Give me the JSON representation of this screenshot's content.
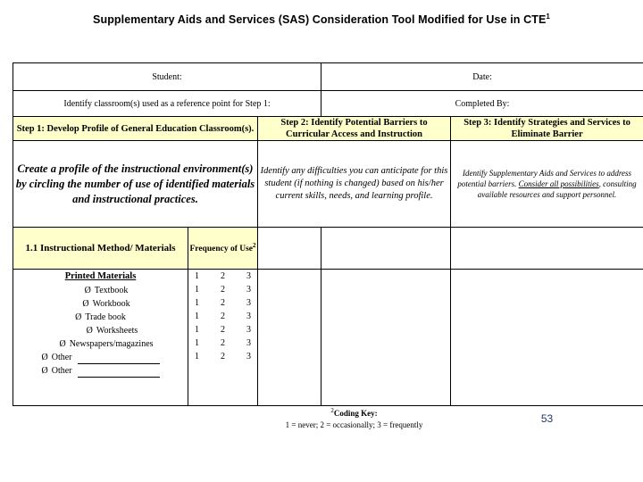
{
  "document": {
    "title": "Supplementary Aids and Services (SAS) Consideration Tool Modified for Use in CTE",
    "title_superscript": "1",
    "page_number": "53"
  },
  "form": {
    "student_label": "Student:",
    "date_label": "Date:",
    "reference_label": "Identify classroom(s) used as a reference point for Step 1:",
    "completed_by_label": "Completed By:"
  },
  "steps": [
    {
      "heading": "Step 1:  Develop Profile of General Education Classroom(s).",
      "description": "Create a profile of the instructional environment(s) by circling the number of use of identified materials and instructional practices."
    },
    {
      "heading": "Step 2: Identify Potential Barriers to Curricular Access and Instruction",
      "description": "Identify any difficulties you can anticipate for this student (if nothing is changed) based on his/her current skills, needs, and learning profile."
    },
    {
      "heading": "Step 3: Identify Strategies and Services to Eliminate Barrier",
      "description_pre": "Identify Supplementary Aids and Services to address potential barriers. ",
      "description_underlined": "Consider all possibilities",
      "description_post": ", consulting available resources and support personnel."
    }
  ],
  "section": {
    "number_label": "1.1   Instructional Method/ Materials",
    "frequency_label": "Frequency of Use",
    "frequency_superscript": "2"
  },
  "materials": {
    "title": "Printed Materials",
    "items": [
      {
        "bullet": "checkbox-right",
        "label": "Textbook",
        "indent": 1
      },
      {
        "bullet": "checkbox-right",
        "label": "Workbook",
        "indent": 1
      },
      {
        "bullet": "checkbox-left",
        "label": "Trade book",
        "indent": 0
      },
      {
        "bullet": "checkbox-right",
        "label": "Worksheets",
        "indent": 2
      },
      {
        "bullet": "checkbox-left",
        "label": "Newspapers/magazines",
        "indent": 1
      },
      {
        "bullet": "checkbox-left",
        "label": "Other",
        "indent": 0,
        "blank": true
      },
      {
        "bullet": "checkbox-left",
        "label": "Other",
        "indent": 0,
        "blank": true
      }
    ]
  },
  "frequency_options": {
    "row_count": 7,
    "values": [
      "1",
      "2",
      "3"
    ]
  },
  "coding_key": {
    "superscript": "2",
    "title": "Coding Key:",
    "legend": "1 = never; 2 = occasionally; 3 = frequently"
  },
  "colors": {
    "header_fill": "#ffffcc",
    "border": "#000000",
    "page_number": "#1f3864"
  }
}
